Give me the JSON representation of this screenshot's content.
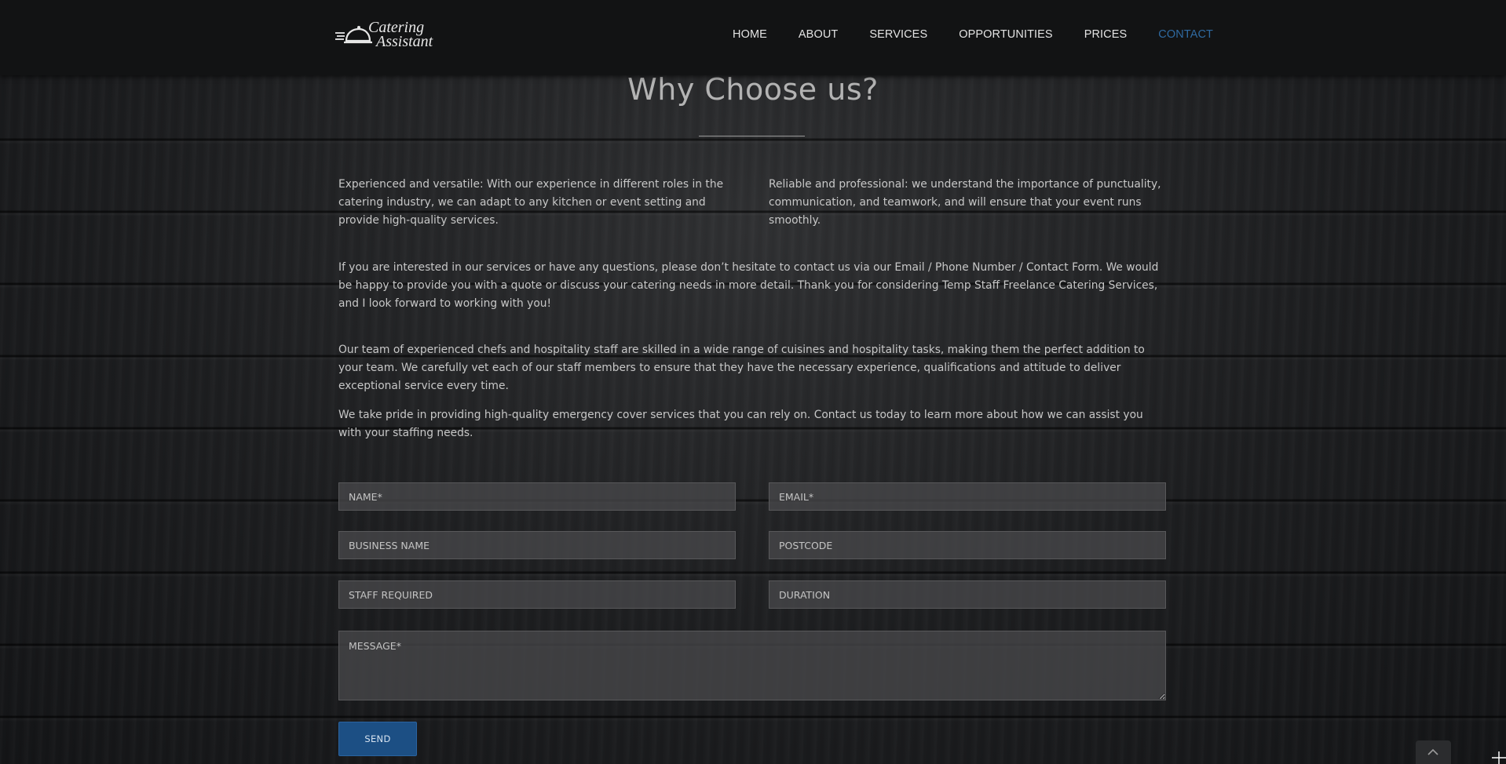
{
  "header": {
    "logo": {
      "line1": "Catering",
      "line2": "Assistant",
      "icon": "cloche-icon"
    },
    "nav": [
      {
        "label": "HOME"
      },
      {
        "label": "ABOUT"
      },
      {
        "label": "SERVICES"
      },
      {
        "label": "OPPORTUNITIES"
      },
      {
        "label": "PRICES"
      },
      {
        "label": "CONTACT",
        "active": true
      }
    ]
  },
  "main": {
    "title": "Why Choose us?",
    "paragraphs": {
      "left": "Experienced and versatile: With our experience in different roles in the catering industry, we can adapt to any kitchen or event setting and provide high-quality services.",
      "right": "Reliable and professional: we understand the importance of punctuality, communication, and teamwork, and will ensure that your event runs smoothly.",
      "p2": "If you are interested in our services or have any questions, please don’t hesitate to contact us via our Email / Phone Number / Contact Form. We would be happy to provide you with a quote or discuss your catering needs in more detail. Thank you for considering Temp Staff Freelance Catering Services, and I look forward to working with you!",
      "p3": "Our team of experienced chefs and hospitality staff are skilled in a wide range of cuisines and hospitality tasks, making them the perfect addition to your team. We carefully vet each of our staff members to ensure that they have the necessary experience, qualifications and attitude to deliver exceptional service every time.",
      "p4": "We take pride in providing high-quality emergency cover services that you can rely on. Contact us today to learn more about how we can assist you with your staffing needs."
    }
  },
  "form": {
    "name_placeholder": "NAME*",
    "email_placeholder": "EMAIL*",
    "business_placeholder": "BUSINESS NAME",
    "postcode_placeholder": "POSTCODE",
    "staff_placeholder": "STAFF REQUIRED",
    "duration_placeholder": "DURATION",
    "message_placeholder": "MESSAGE*",
    "send_label": "SEND"
  },
  "icons": {
    "scroll_top": "chevron-up-icon"
  },
  "colors": {
    "accent": "#2f6aa1",
    "button": "#1c4f84",
    "header_bg": "#121314"
  }
}
